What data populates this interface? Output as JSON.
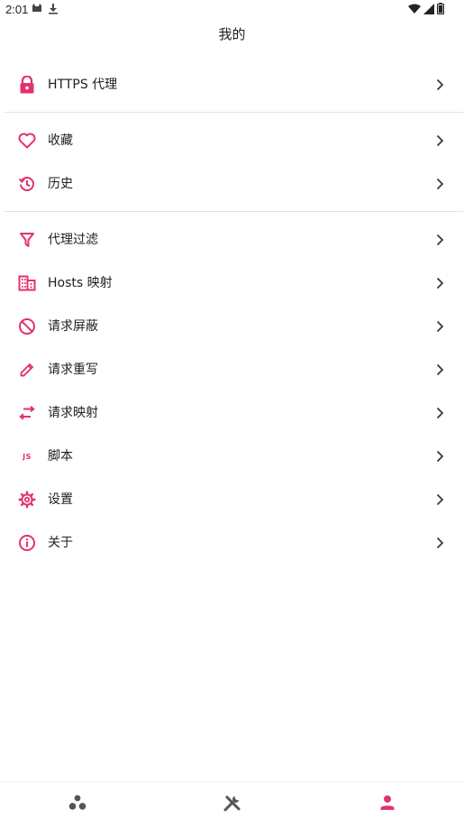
{
  "status_bar": {
    "time": "2:01",
    "left_icons": [
      "cat-notification-icon",
      "download-icon"
    ],
    "right_icons": [
      "wifi-icon",
      "signal-icon",
      "battery-icon"
    ]
  },
  "header": {
    "title": "我的"
  },
  "colors": {
    "accent": "#e2336b",
    "text": "#1e1e1e",
    "chevron": "#3a3a3a",
    "divider": "#e2e2e2",
    "nav_inactive": "#555555"
  },
  "menu": {
    "groups": [
      [
        {
          "label": "HTTPS 代理",
          "icon": "lock-icon"
        }
      ],
      [
        {
          "label": "收藏",
          "icon": "heart-icon"
        },
        {
          "label": "历史",
          "icon": "history-icon"
        }
      ],
      [
        {
          "label": "代理过滤",
          "icon": "filter-icon"
        },
        {
          "label": "Hosts 映射",
          "icon": "domain-icon"
        },
        {
          "label": "请求屏蔽",
          "icon": "block-icon"
        },
        {
          "label": "请求重写",
          "icon": "pencil-icon"
        },
        {
          "label": "请求映射",
          "icon": "swap-icon"
        },
        {
          "label": "脚本",
          "icon": "js-icon",
          "icon_text": "JS"
        },
        {
          "label": "设置",
          "icon": "gear-icon"
        },
        {
          "label": "关于",
          "icon": "info-icon"
        }
      ]
    ]
  },
  "bottom_nav": {
    "tabs": [
      {
        "icon": "bubbles-icon",
        "active": false
      },
      {
        "icon": "tools-icon",
        "active": false
      },
      {
        "icon": "person-icon",
        "active": true
      }
    ]
  }
}
